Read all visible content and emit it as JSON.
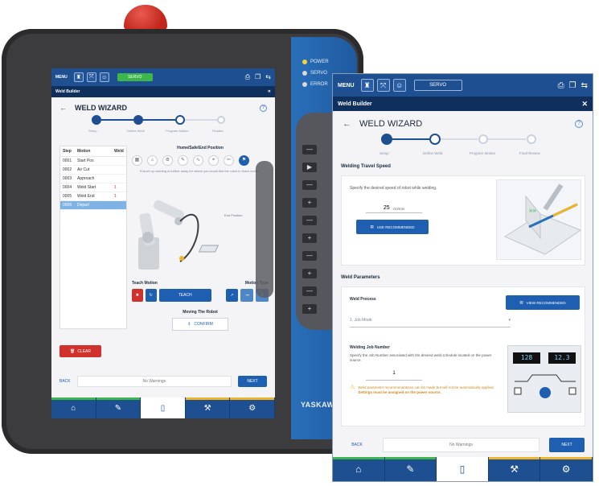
{
  "hardware": {
    "leds": [
      "POWER",
      "SERVO",
      "ERROR"
    ],
    "brand": "YASKAWA"
  },
  "back_screen": {
    "menu": "MENU",
    "mode": "SERVO",
    "subtitle": "Weld Builder",
    "close": "✕",
    "wizard_title": "WELD WIZARD",
    "steps": [
      "Setup",
      "Define Weld",
      "Program Motion",
      "Finalize"
    ],
    "list_headers": {
      "step": "Step",
      "motion": "Motion",
      "weld": "Weld"
    },
    "list_rows": [
      {
        "step": "0001",
        "motion": "Start Pos",
        "weld": ""
      },
      {
        "step": "0002",
        "motion": "Air Cut",
        "weld": ""
      },
      {
        "step": "0003",
        "motion": "Approach",
        "weld": ""
      },
      {
        "step": "0004",
        "motion": "Weld Start",
        "weld": "1"
      },
      {
        "step": "0005",
        "motion": "Weld End",
        "weld": "1"
      },
      {
        "step": "0006",
        "motion": "Depart",
        "weld": ""
      }
    ],
    "position_title": "Home/Safe/End Position",
    "position_hint": "If touch up welding is further away for where you would like the robot to finish motion.",
    "teach_motion": "Teach Motion",
    "motion_type": "Motion Type",
    "teach_btn": "TEACH",
    "moving_title": "Moving The Robot",
    "moving_btn": "CONFIRM",
    "clear": "CLEAR",
    "back": "BACK",
    "warnings": "No Warnings",
    "next": "NEXT"
  },
  "front_screen": {
    "menu": "MENU",
    "mode": "SERVO",
    "subtitle": "Weld Builder",
    "close": "✕",
    "wizard_title": "WELD WIZARD",
    "steps": [
      "Setup",
      "Define Weld",
      "Program Motion",
      "Final Review"
    ],
    "travel_speed": {
      "title": "Welding Travel Speed",
      "desc": "Specify the desired speed of robot while welding.",
      "value": "25",
      "unit": "cm/min",
      "button": "USE RECOMMENDED"
    },
    "params": {
      "title": "Weld Parameters",
      "process_label": "Weld Process",
      "view_button": "VIEW RECOMMENDED",
      "process_placeholder": "1. Job Mode",
      "job_title": "Welding Job Number",
      "job_desc": "Specify the Job Number associated with the desired weld schedule located on the power source.",
      "job_value": "1",
      "warning_line1": "Weld parameter recommendations can be made but will not be automatically applied.",
      "warning_line2": "Settings must be assigned on the power source.",
      "display_left": "128",
      "display_right": "12.3"
    },
    "back": "BACK",
    "warnings": "No Warnings",
    "next": "NEXT"
  },
  "nav_icons": [
    "home-icon",
    "torch-icon",
    "clipboard-icon",
    "wrench-icon",
    "settings-icon"
  ],
  "colors": {
    "primary": "#1d4f91",
    "accent": "#1f5fb1",
    "success": "#3cb54a",
    "danger": "#d0312d",
    "warning": "#f0b429"
  }
}
